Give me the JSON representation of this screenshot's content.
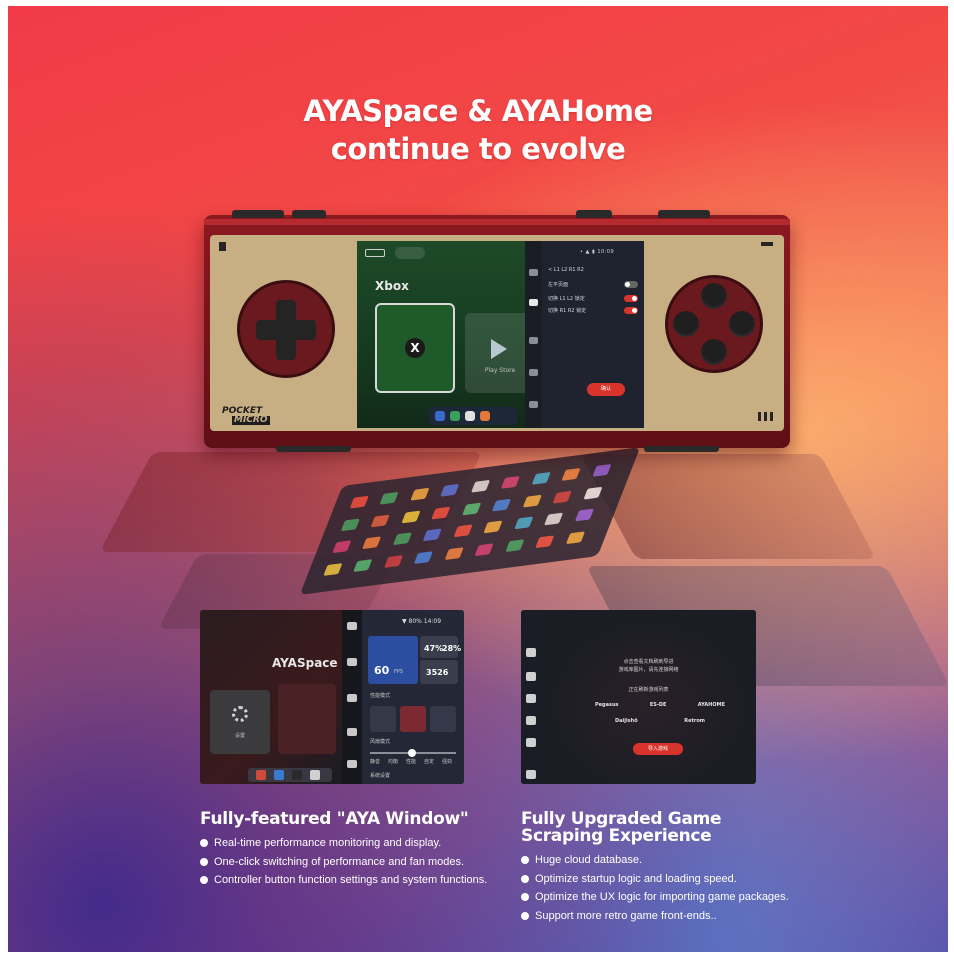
{
  "headline": {
    "line1": "AYASpace & AYAHome",
    "line2": "continue to evolve"
  },
  "device": {
    "brand_line1": "POCKET",
    "brand_line2": "MICRO",
    "screen": {
      "title": "Xbox",
      "play_store_label": "Play Store",
      "status": "• ▲ ▮ 10:09",
      "panel_rows": [
        "左平页面",
        "切换 L1 L2 锁定",
        "切换 R1 R2 锁定"
      ],
      "panel_button": "确认",
      "panel_header": "< L1 L2 R1 R2"
    }
  },
  "left_shot": {
    "title": "AYASpace",
    "card_caption": "设置",
    "status": "▼ 80% 14:09",
    "cpu_value": "60",
    "cpu_unit": "FPS",
    "gpu_pct": "47%",
    "cpu_pct": "28%",
    "mem_value": "3526",
    "mode_label": "性能模式",
    "fan_label": "风扇模式",
    "fan_scale": [
      "静音",
      "均衡",
      "性能",
      "自定",
      "强劲"
    ],
    "extra_label": "系统设置"
  },
  "right_shot": {
    "line1": "点击查看文档刷刺导进",
    "line2": "游戏库图片，请先连接网络",
    "line3": "正在刷新游戏列表",
    "logos_row1": [
      "Pegasus",
      "ES-DE",
      "AYAHOME"
    ],
    "logos_row2": [
      "Daijishō",
      "Retrom"
    ],
    "button": "导入游戏"
  },
  "features": [
    {
      "title": "Fully-featured \"AYA Window\"",
      "bullets": [
        "Real-time performance monitoring and display.",
        "One-click switching of performance and fan modes.",
        "Controller button function settings and system functions."
      ]
    },
    {
      "title_line1": "Fully Upgraded Game",
      "title_line2": "Scraping Experience",
      "bullets": [
        "Huge cloud database.",
        "Optimize startup logic and loading speed.",
        "Optimize the UX logic for importing game packages.",
        "Support more retro game front-ends.."
      ]
    }
  ],
  "colors": {
    "accent_red": "#d9342b",
    "device_red": "#8c1820",
    "device_beige": "#c7ae83"
  }
}
